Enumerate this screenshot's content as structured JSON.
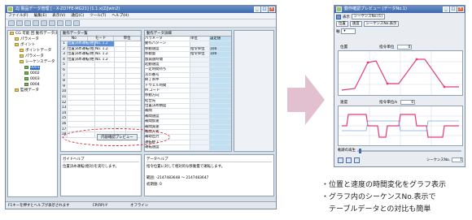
{
  "left_window": {
    "title": "ZJ 製品データ管理 [ - X-ZO7FE-MG21] (1.1.x(Z/Jwin2)",
    "menu": [
      "ファイル(F)",
      "編集(E)",
      "表示(V)",
      "通信(C)",
      "ツール(T)",
      "ヘルプ(H)"
    ],
    "tree": [
      {
        "label": "CG 可能 回 動作データ(Program) - C2",
        "level": 0,
        "selected": false
      },
      {
        "label": "パラメータ",
        "level": 1,
        "selected": false
      },
      {
        "label": "ポイント",
        "level": 1,
        "selected": false
      },
      {
        "label": "ポイントデータ",
        "level": 2,
        "selected": false
      },
      {
        "label": "パラメータ",
        "level": 2,
        "selected": false
      },
      {
        "label": "シーケンスデータ",
        "level": 2,
        "selected": false
      },
      {
        "label": "0001",
        "level": 3,
        "selected": true
      },
      {
        "label": "0002",
        "level": 3,
        "selected": false
      },
      {
        "label": "0003",
        "level": 3,
        "selected": false
      },
      {
        "label": "0004",
        "level": 3,
        "selected": false
      },
      {
        "label": "監視データ",
        "level": 1,
        "selected": false
      }
    ],
    "table_header": "動作データ一覧",
    "table_columns": [
      "No",
      "モード",
      "単位"
    ],
    "table_rows": [
      {
        "n": "1",
        "a": "位置決め運転(絶対)",
        "b": "No. 1.2",
        "c": "",
        "hl": true
      },
      {
        "n": "2",
        "a": "位置決め運転(相対)",
        "b": "No. 1.2",
        "c": "",
        "hl": false
      },
      {
        "n": "3",
        "a": "位置決め運転(絶対)",
        "b": "No. 1.2",
        "c": "",
        "hl": false
      },
      {
        "n": "4",
        "a": "位置決め運転(絶対)",
        "b": "No. 1.2",
        "c": "",
        "hl": false
      },
      {
        "n": "5",
        "a": "",
        "b": "",
        "c": "",
        "hl": false
      },
      {
        "n": "6",
        "a": "",
        "b": "",
        "c": "",
        "hl": false
      },
      {
        "n": "7",
        "a": "",
        "b": "",
        "c": "",
        "hl": false
      },
      {
        "n": "8",
        "a": "",
        "b": "",
        "c": "",
        "hl": false
      },
      {
        "n": "9",
        "a": "",
        "b": "",
        "c": "",
        "hl": false
      },
      {
        "n": "10",
        "a": "",
        "b": "",
        "c": "",
        "hl": false
      },
      {
        "n": "11",
        "a": "",
        "b": "",
        "c": "",
        "hl": false
      },
      {
        "n": "12",
        "a": "",
        "b": "",
        "c": "",
        "hl": false
      },
      {
        "n": "13",
        "a": "",
        "b": "",
        "c": "",
        "hl": false
      },
      {
        "n": "14",
        "a": "",
        "b": "",
        "c": "",
        "hl": false
      },
      {
        "n": "15",
        "a": "",
        "b": "",
        "c": "",
        "hl": false
      },
      {
        "n": "16",
        "a": "",
        "b": "",
        "c": "",
        "hl": false
      },
      {
        "n": "17",
        "a": "",
        "b": "",
        "c": "",
        "hl": false
      },
      {
        "n": "18",
        "a": "",
        "b": "",
        "c": "",
        "hl": false
      }
    ],
    "detail_header": "動作データ詳細",
    "detail_rows": [
      {
        "k": "パラメータ",
        "v": "単位",
        "w": "設定値"
      },
      {
        "k": "動作パターン",
        "v": "",
        "w": ""
      },
      {
        "k": "移動速度",
        "v": "指令単位",
        "w": "100"
      },
      {
        "k": "移動量",
        "v": "指令単位",
        "w": "100"
      },
      {
        "k": "加減速時間",
        "v": "",
        "w": ""
      },
      {
        "k": "起動速度",
        "v": "",
        "w": ""
      },
      {
        "k": "一定時間待ち",
        "v": "",
        "w": ""
      },
      {
        "k": "次の番号",
        "v": "",
        "w": ""
      },
      {
        "k": "終了条件",
        "v": "",
        "w": ""
      },
      {
        "k": "ドウェル時間",
        "v": "",
        "w": ""
      },
      {
        "k": "M コード",
        "v": "",
        "w": ""
      },
      {
        "k": "移動方向",
        "v": "",
        "w": ""
      },
      {
        "k": "結合先",
        "v": "",
        "w": ""
      },
      {
        "k": "位置決め精度",
        "v": "",
        "w": ""
      },
      {
        "k": "補間",
        "v": "",
        "w": ""
      },
      {
        "k": "補間速度",
        "v": "",
        "w": ""
      },
      {
        "k": "補間加速",
        "v": "",
        "w": ""
      },
      {
        "k": "補間減速",
        "v": "",
        "w": ""
      },
      {
        "k": "補間方式",
        "v": "",
        "w": ""
      },
      {
        "k": "補助出力",
        "v": "",
        "w": ""
      },
      {
        "k": "運転終了",
        "v": "",
        "w": ""
      },
      {
        "k": "運転速度",
        "v": "",
        "w": ""
      }
    ],
    "preview_button": "内容確認プレビュー",
    "bottom_left_title": "ガイドヘルプ",
    "bottom_left_text": "位置決め運転(相対)を実行します。",
    "bottom_right_title": "データヘルプ",
    "bottom_right_text": "指令位置に対して相対的な移動量で運転します。",
    "bottom_right_range": "範囲: -2147483648 ～ 2147483647",
    "bottom_right_init": "初期値: 0",
    "status_items": [
      "F1キーを押すとヘルプが表示されます",
      "CP(RP)-Y",
      "オフライン"
    ]
  },
  "right_window": {
    "title": "動作確認プレビュー (データNo.1)",
    "toolbar_label": "表示",
    "sequence_select": "シーケンスNo.(1)",
    "tabs": [
      "位置",
      "速度",
      "シーケンスNo.表示"
    ],
    "axis_select": "軸",
    "position_label": "位置",
    "position_unit": "指令単位",
    "position_value": "0",
    "velocity_label": "速度",
    "velocity_unit": "指令単位/s",
    "velocity_value": "0",
    "slider_label": "軌跡の再生",
    "seq_label": "シーケンスNo.",
    "seq_value": "1"
  },
  "captions": [
    "・位置と速度の時間変化をグラフ表示",
    "・グラフ内のシーケンスNo.表示で",
    "　テーブルデータとの対比も簡単"
  ],
  "colors": {
    "highlight_ring": "#d21f2a",
    "arrow": "#e3c0d0",
    "position_line": "#e23b7a",
    "velocity_line": "#e23b7a"
  }
}
